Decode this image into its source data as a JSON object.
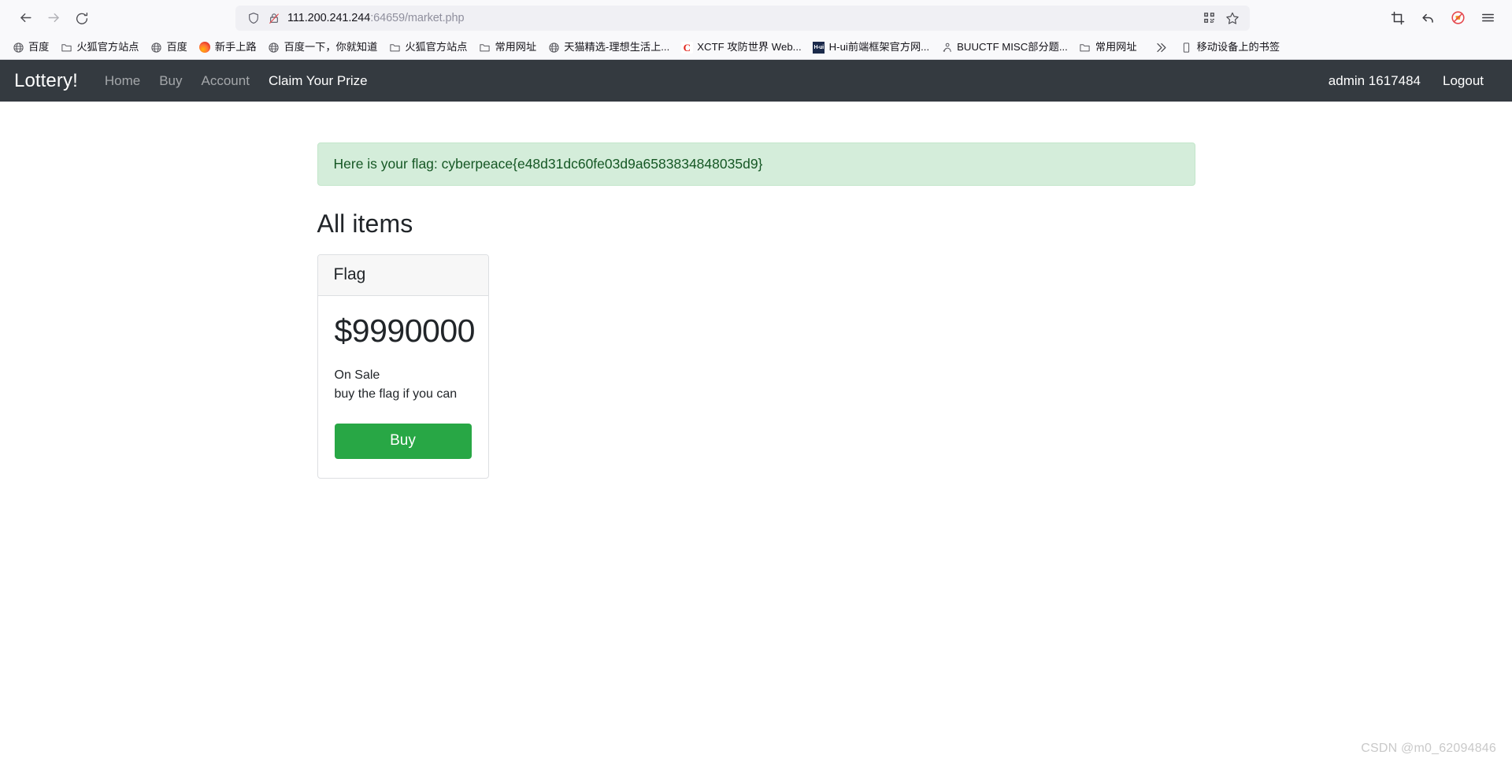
{
  "browser": {
    "nav": {
      "back_icon": "arrow-left-icon",
      "forward_icon": "arrow-right-icon",
      "reload_icon": "reload-icon"
    },
    "urlbar": {
      "shield_icon": "shield-icon",
      "insecure_icon": "lock-crossed-icon",
      "url_host": "111.200.241.244",
      "url_rest": ":64659/market.php",
      "full_url": "111.200.241.244:64659/market.php",
      "qr_icon": "qr-code-icon",
      "bookmark_icon": "star-icon"
    },
    "toolbar_right": [
      {
        "name": "screenshot-icon",
        "glyph": "crop-icon"
      },
      {
        "name": "undo-close-tab-icon",
        "glyph": "undo-arrow-icon"
      },
      {
        "name": "adblock-icon",
        "glyph": "blocked-ad-icon"
      },
      {
        "name": "app-menu-icon",
        "glyph": "hamburger-icon"
      }
    ],
    "bookmarks": [
      {
        "label": "百度",
        "icon": "globe-icon"
      },
      {
        "label": "火狐官方站点",
        "icon": "folder-icon"
      },
      {
        "label": "百度",
        "icon": "globe-icon"
      },
      {
        "label": "新手上路",
        "icon": "firefox-icon"
      },
      {
        "label": "百度一下，你就知道",
        "icon": "globe-icon"
      },
      {
        "label": "火狐官方站点",
        "icon": "folder-icon"
      },
      {
        "label": "常用网址",
        "icon": "folder-icon"
      },
      {
        "label": "天猫精选-理想生活上...",
        "icon": "globe-icon"
      },
      {
        "label": "XCTF 攻防世界 Web...",
        "icon": "c-letter-icon"
      },
      {
        "label": "H-ui前端框架官方网...",
        "icon": "hui-icon"
      },
      {
        "label": "BUUCTF MISC部分题...",
        "icon": "person-icon"
      },
      {
        "label": "常用网址",
        "icon": "folder-icon"
      }
    ],
    "bookmarks_overflow_icon": "chevron-double-right-icon",
    "mobile_bookmarks": {
      "label": "移动设备上的书签",
      "icon": "mobile-icon"
    }
  },
  "site": {
    "navbar": {
      "brand": "Lottery!",
      "links": [
        {
          "label": "Home",
          "active": false
        },
        {
          "label": "Buy",
          "active": false
        },
        {
          "label": "Account",
          "active": false
        },
        {
          "label": "Claim Your Prize",
          "active": true
        }
      ],
      "user": "admin 1617484",
      "logout": "Logout"
    },
    "alert": {
      "text": "Here is your flag: cyberpeace{e48d31dc60fe03d9a6583834848035d9}",
      "type": "success",
      "bg_color": "#d4edda",
      "text_color": "#155724",
      "border_color": "#c3e6cb"
    },
    "heading": "All items",
    "items": [
      {
        "title": "Flag",
        "price": "$9990000",
        "status": "On Sale",
        "description": "buy the flag if you can",
        "buy_label": "Buy",
        "buy_color": "#28a745"
      }
    ]
  },
  "watermark": "CSDN @m0_62094846"
}
